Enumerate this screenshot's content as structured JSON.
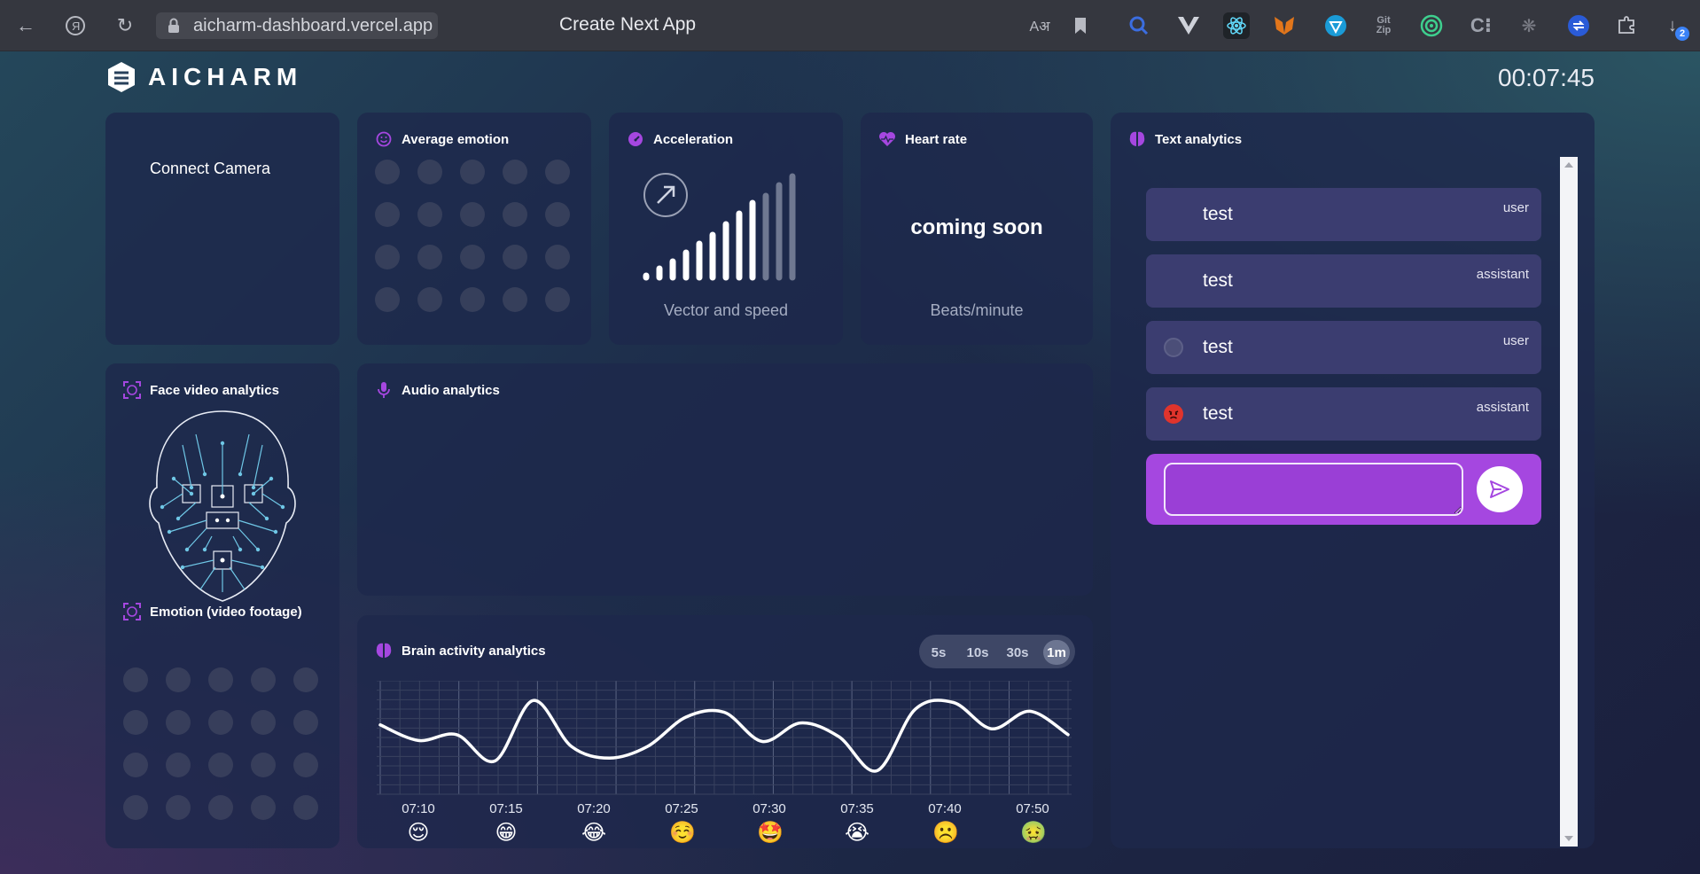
{
  "browser": {
    "url": "aicharm-dashboard.vercel.app",
    "tab_title": "Create Next App",
    "download_badge": "2"
  },
  "header": {
    "logo_text": "AICHARM",
    "timer": "00:07:45"
  },
  "connect_camera": {
    "label": "Connect Camera"
  },
  "average_emotion": {
    "title": "Average emotion"
  },
  "acceleration": {
    "title": "Acceleration",
    "subtitle": "Vector and speed"
  },
  "heart_rate": {
    "title": "Heart rate",
    "status": "coming soon",
    "unit": "Beats/minute"
  },
  "face_video": {
    "title": "Face video analytics"
  },
  "emotion_video": {
    "title": "Emotion (video footage)"
  },
  "audio": {
    "title": "Audio analytics"
  },
  "brain": {
    "title": "Brain activity analytics",
    "ranges": [
      "5s",
      "10s",
      "30s",
      "1m"
    ],
    "selected_range": "1m"
  },
  "text_analytics": {
    "title": "Text analytics",
    "messages": [
      {
        "text": "test",
        "role": "user"
      },
      {
        "text": "test",
        "role": "assistant"
      },
      {
        "text": "test",
        "role": "user"
      },
      {
        "text": "test",
        "role": "assistant"
      }
    ],
    "input_value": ""
  },
  "chart_data": {
    "type": "line",
    "x": [
      "07:10",
      "07:15",
      "07:20",
      "07:25",
      "07:30",
      "07:35",
      "07:40",
      "07:50"
    ],
    "emojis": [
      "😌",
      "😁",
      "😂",
      "☺️",
      "🤩",
      "😭",
      "☹️",
      "🤢"
    ],
    "series": [
      {
        "values": [
          0.62,
          0.46,
          0.52,
          0.25,
          0.87,
          0.4,
          0.28,
          0.4,
          0.7,
          0.75,
          0.45,
          0.64,
          0.5,
          0.15,
          0.78,
          0.85,
          0.58,
          0.76,
          0.52
        ]
      }
    ],
    "grid": true
  },
  "colors": {
    "accent": "#a547e0",
    "card": "#1e284b",
    "chat_bubble": "#3b3d70"
  }
}
